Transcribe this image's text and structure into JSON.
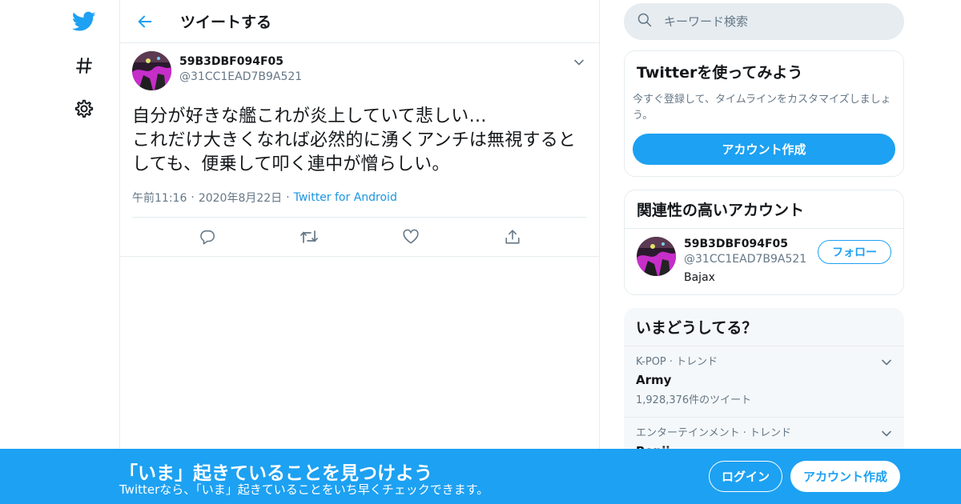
{
  "nav": {
    "items": [
      {
        "icon": "twitter-bird-icon"
      },
      {
        "icon": "hashtag-icon"
      },
      {
        "icon": "gear-icon"
      }
    ]
  },
  "header": {
    "title": "ツイートする"
  },
  "tweet": {
    "author_name": "59B3DBF094F05",
    "author_handle": "@31CC1EAD7B9A521",
    "text": "自分が好きな艦これが炎上していて悲しい…\nこれだけ大きくなれば必然的に湧くアンチは無視するとしても、便乗して叩く連中が憎らしい。",
    "time": "午前11:16",
    "date": "2020年8月22日",
    "source": "Twitter for Android",
    "separator": "·"
  },
  "search": {
    "placeholder": "キーワード検索"
  },
  "signup_card": {
    "title": "Twitterを使ってみよう",
    "description": "今すぐ登録して、タイムラインをカスタマイズしましょう。",
    "button": "アカウント作成"
  },
  "related": {
    "title": "関連性の高いアカウント",
    "user": {
      "name": "59B3DBF094F05",
      "handle": "@31CC1EAD7B9A521",
      "bio": "Bajax",
      "follow_label": "フォロー"
    }
  },
  "trends": {
    "title": "いまどうしてる？",
    "items": [
      {
        "context": "K-POP · トレンド",
        "name": "Army",
        "count": "1,928,376件のツイート"
      },
      {
        "context": "エンターテインメント · トレンド",
        "name": "Benji",
        "count": ""
      }
    ]
  },
  "bottom_bar": {
    "title": "「いま」起きていることを見つけよう",
    "subtitle": "Twitterなら、「いま」起きていることをいち早くチェックできます。",
    "login": "ログイン",
    "signup": "アカウント作成"
  },
  "colors": {
    "accent": "#1da1f2",
    "link": "#1b95e0",
    "muted": "#657786",
    "border": "#e6ecf0"
  }
}
